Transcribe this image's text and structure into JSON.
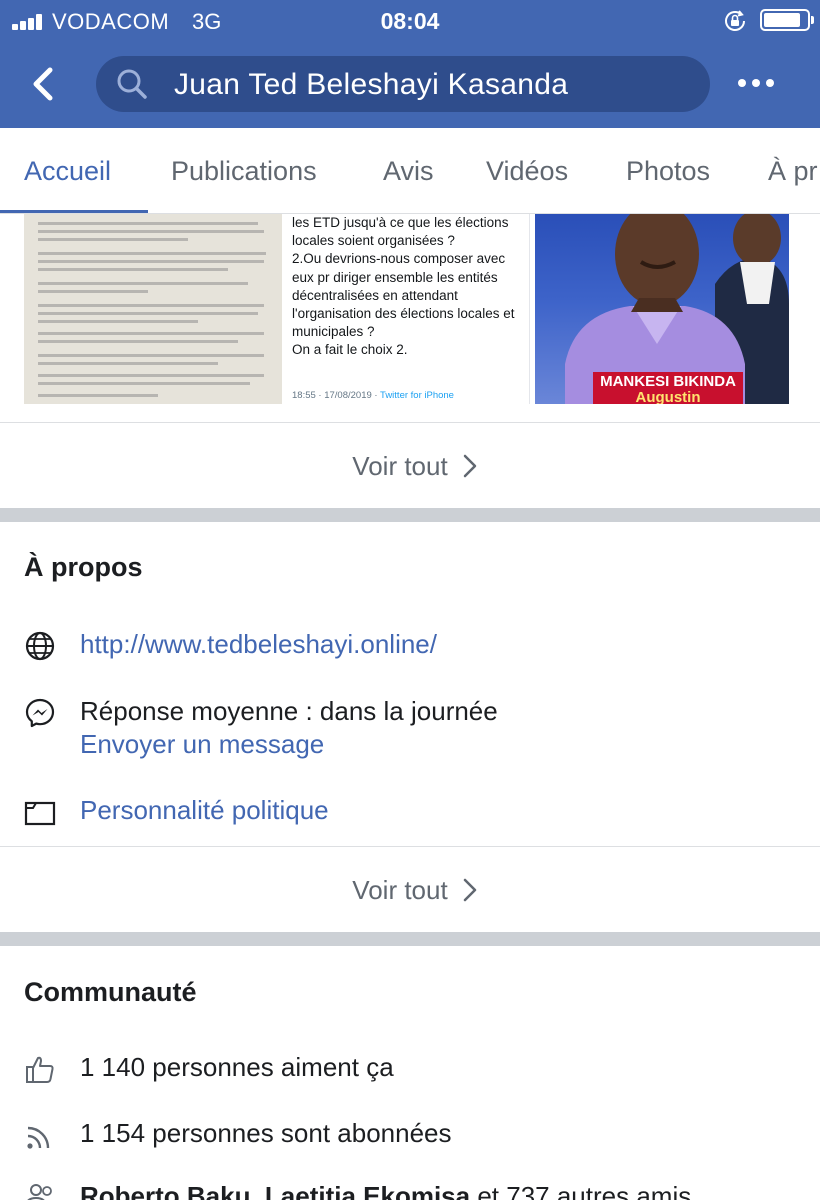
{
  "status_bar": {
    "carrier": "VODACOM",
    "network": "3G",
    "time": "08:04"
  },
  "header": {
    "search_text": "Juan Ted Beleshayi Kasanda"
  },
  "tabs": [
    {
      "label": "Accueil",
      "active": true
    },
    {
      "label": "Publications",
      "active": false
    },
    {
      "label": "Avis",
      "active": false
    },
    {
      "label": "Vidéos",
      "active": false
    },
    {
      "label": "Photos",
      "active": false
    },
    {
      "label": "À pr",
      "active": false
    }
  ],
  "photos": {
    "tweet_lines": [
      "les ETD jusqu'à ce que les élections",
      "locales soient organisées ?",
      "2.Ou devrions-nous composer avec",
      "eux pr diriger ensemble les entités",
      "décentralisées en attendant",
      "l'organisation des élections locales et",
      "municipales ?",
      "On a fait le choix 2."
    ],
    "tweet_time": "18:55 · 17/08/2019 ·",
    "tweet_source": "Twitter for iPhone",
    "poster_name": "MANKESI BIKINDA",
    "poster_firstname": "Augustin"
  },
  "photos_card": {
    "see_all": "Voir tout"
  },
  "about": {
    "title": "À propos",
    "website": "http://www.tedbeleshayi.online/",
    "response": "Réponse moyenne : dans la journée",
    "send_message": "Envoyer un message",
    "category": "Personnalité politique",
    "see_all": "Voir tout"
  },
  "community": {
    "title": "Communauté",
    "likes": "1 140 personnes aiment ça",
    "followers": "1 154 personnes sont abonnées",
    "friends_names": "Roberto Baku, Laetitia Ekomisa",
    "friends_rest": " et 737 autres amis"
  },
  "colors": {
    "brand": "#4267b2",
    "search_bg": "#2f4d8c",
    "divider": "#ccd0d5",
    "muted": "#606770"
  },
  "icons": {
    "back": "chevron-left-icon",
    "search": "search-icon",
    "more": "more-dots-icon",
    "website": "globe-icon",
    "messenger": "messenger-icon",
    "category": "category-icon",
    "likes": "thumbs-up-icon",
    "followers": "rss-icon",
    "friends": "friends-icon"
  }
}
